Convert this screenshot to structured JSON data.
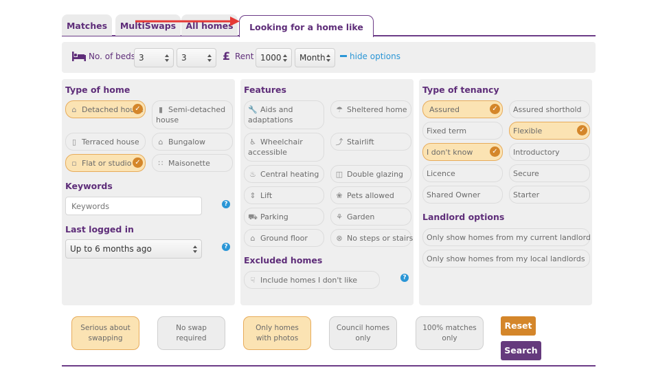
{
  "tabs": [
    {
      "label": "Matches",
      "active": false
    },
    {
      "label": "MultiSwaps",
      "active": false
    },
    {
      "label": "All homes",
      "active": false
    },
    {
      "label": "Looking for a home like yours",
      "active": true
    }
  ],
  "options_bar": {
    "beds_label": "No. of beds",
    "beds_min": "3",
    "beds_max": "3",
    "rent_label": "Rent",
    "currency_symbol": "£",
    "rent_value": "1000",
    "rent_period": "Month",
    "hide_options_label": "hide options"
  },
  "type_of_home": {
    "title": "Type of home",
    "items": [
      {
        "label": "Detached house",
        "selected": true,
        "icon": "detached-house-icon"
      },
      {
        "label": "Semi-detached house",
        "selected": false,
        "icon": "semi-detached-icon"
      },
      {
        "label": "Terraced house",
        "selected": false,
        "icon": "terraced-house-icon"
      },
      {
        "label": "Bungalow",
        "selected": false,
        "icon": "bungalow-icon"
      },
      {
        "label": "Flat or studio",
        "selected": true,
        "icon": "flat-icon"
      },
      {
        "label": "Maisonette",
        "selected": false,
        "icon": "maisonette-icon"
      }
    ]
  },
  "keywords": {
    "title": "Keywords",
    "placeholder": "Keywords",
    "value": ""
  },
  "last_logged_in": {
    "title": "Last logged in",
    "value": "Up to 6 months ago"
  },
  "features": {
    "title": "Features",
    "items": [
      {
        "label": "Aids and adaptations",
        "icon": "wrench-icon"
      },
      {
        "label": "Sheltered home",
        "icon": "umbrella-icon"
      },
      {
        "label": "Wheelchair accessible",
        "icon": "wheelchair-icon"
      },
      {
        "label": "Stairlift",
        "icon": "stairlift-icon"
      },
      {
        "label": "Central heating",
        "icon": "flame-icon"
      },
      {
        "label": "Double glazing",
        "icon": "window-icon"
      },
      {
        "label": "Lift",
        "icon": "lift-icon"
      },
      {
        "label": "Pets allowed",
        "icon": "paw-icon"
      },
      {
        "label": "Parking",
        "icon": "car-icon"
      },
      {
        "label": "Garden",
        "icon": "plant-icon"
      },
      {
        "label": "Ground floor",
        "icon": "ground-floor-icon"
      },
      {
        "label": "No steps or stairs",
        "icon": "no-steps-icon"
      }
    ]
  },
  "excluded_homes": {
    "title": "Excluded homes",
    "item": "Include homes I don't like"
  },
  "type_of_tenancy": {
    "title": "Type of tenancy",
    "items": [
      {
        "label": "Assured",
        "selected": true
      },
      {
        "label": "Assured shorthold",
        "selected": false
      },
      {
        "label": "Fixed term",
        "selected": false
      },
      {
        "label": "Flexible",
        "selected": true
      },
      {
        "label": "I don't know",
        "selected": true
      },
      {
        "label": "Introductory",
        "selected": false
      },
      {
        "label": "Licence",
        "selected": false
      },
      {
        "label": "Secure",
        "selected": false
      },
      {
        "label": "Shared Owner",
        "selected": false
      },
      {
        "label": "Starter",
        "selected": false
      }
    ]
  },
  "landlord_options": {
    "title": "Landlord options",
    "items": [
      "Only show homes from my current landlord",
      "Only show homes from my local landlords"
    ]
  },
  "toggles": [
    {
      "label": "Serious about swapping",
      "selected": true
    },
    {
      "label": "No swap required",
      "selected": false
    },
    {
      "label": "Only homes with photos",
      "selected": true
    },
    {
      "label": "Council homes only",
      "selected": false
    },
    {
      "label": "100% matches only",
      "selected": false
    }
  ],
  "buttons": {
    "reset": "Reset",
    "search": "Search"
  },
  "colors": {
    "purple": "#5e2d79",
    "orange": "#d4862a",
    "selected_bg": "#fbe3b3",
    "link_blue": "#2a96d6"
  }
}
